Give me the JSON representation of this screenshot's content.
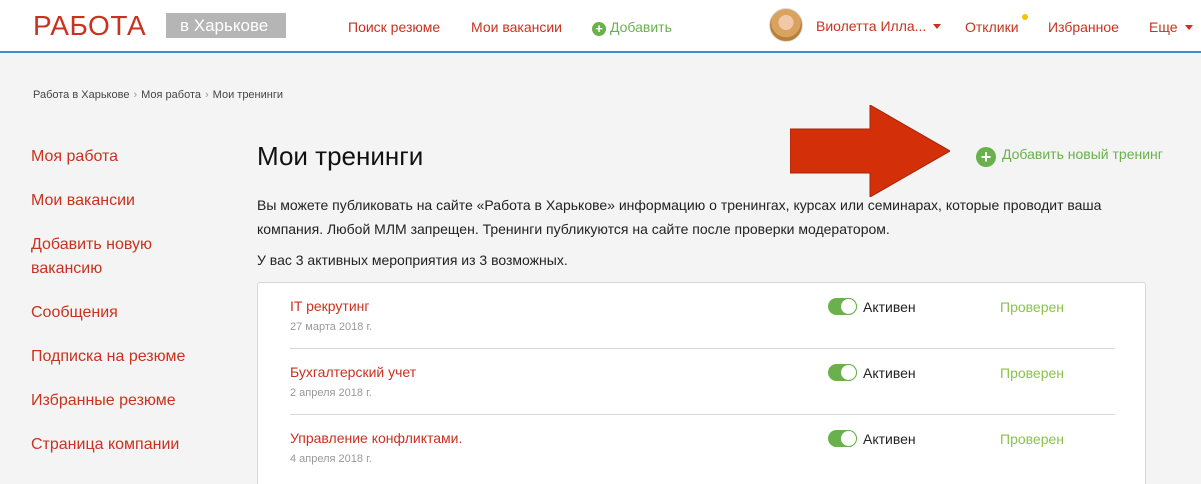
{
  "header": {
    "logo_text": "РАБОТА",
    "logo_city": "в Харькове",
    "nav": {
      "search_resume": "Поиск резюме",
      "my_vacancies": "Мои вакансии",
      "add": "Добавить"
    },
    "user_name": "Виолетта Илла...",
    "responses": "Отклики",
    "favorites": "Избранное",
    "more": "Еще"
  },
  "breadcrumb": [
    "Работа в Харькове",
    "Моя работа",
    "Мои тренинги"
  ],
  "sidebar": {
    "items": [
      "Моя работа",
      "Мои вакансии",
      "Добавить новую вакансию",
      "Сообщения",
      "Подписка на резюме",
      "Избранные резюме",
      "Страница компании"
    ]
  },
  "main": {
    "title": "Мои тренинги",
    "add_training": "Добавить новый тренинг",
    "description": "Вы можете публиковать на сайте «Работа в Харькове» информацию о тренингах, курсах или семинарах, которые проводит ваша компания. Любой МЛМ запрещен. Тренинги публикуются на сайте после проверки модератором.",
    "active_count": "У вас 3 активных мероприятия из 3 возможных.",
    "trainings": [
      {
        "name": "IT рекрутинг",
        "date": "27 марта 2018 г.",
        "status": "Активен",
        "moderation": "Проверен",
        "active": true
      },
      {
        "name": "Бухгалтерский учет",
        "date": "2 апреля 2018 г.",
        "status": "Активен",
        "moderation": "Проверен",
        "active": true
      },
      {
        "name": "Управление конфликтами.",
        "date": "4 апреля 2018 г.",
        "status": "Активен",
        "moderation": "Проверен",
        "active": true
      }
    ]
  },
  "colors": {
    "brand_red": "#c8321e",
    "accent_green": "#6ab04c",
    "header_border": "#3c8dd5",
    "annotation_arrow": "#d3300a"
  },
  "icons": [
    "plus-circle-icon",
    "caret-down-icon",
    "notification-dot-icon",
    "toggle-switch-icon",
    "annotation-arrow-icon"
  ]
}
